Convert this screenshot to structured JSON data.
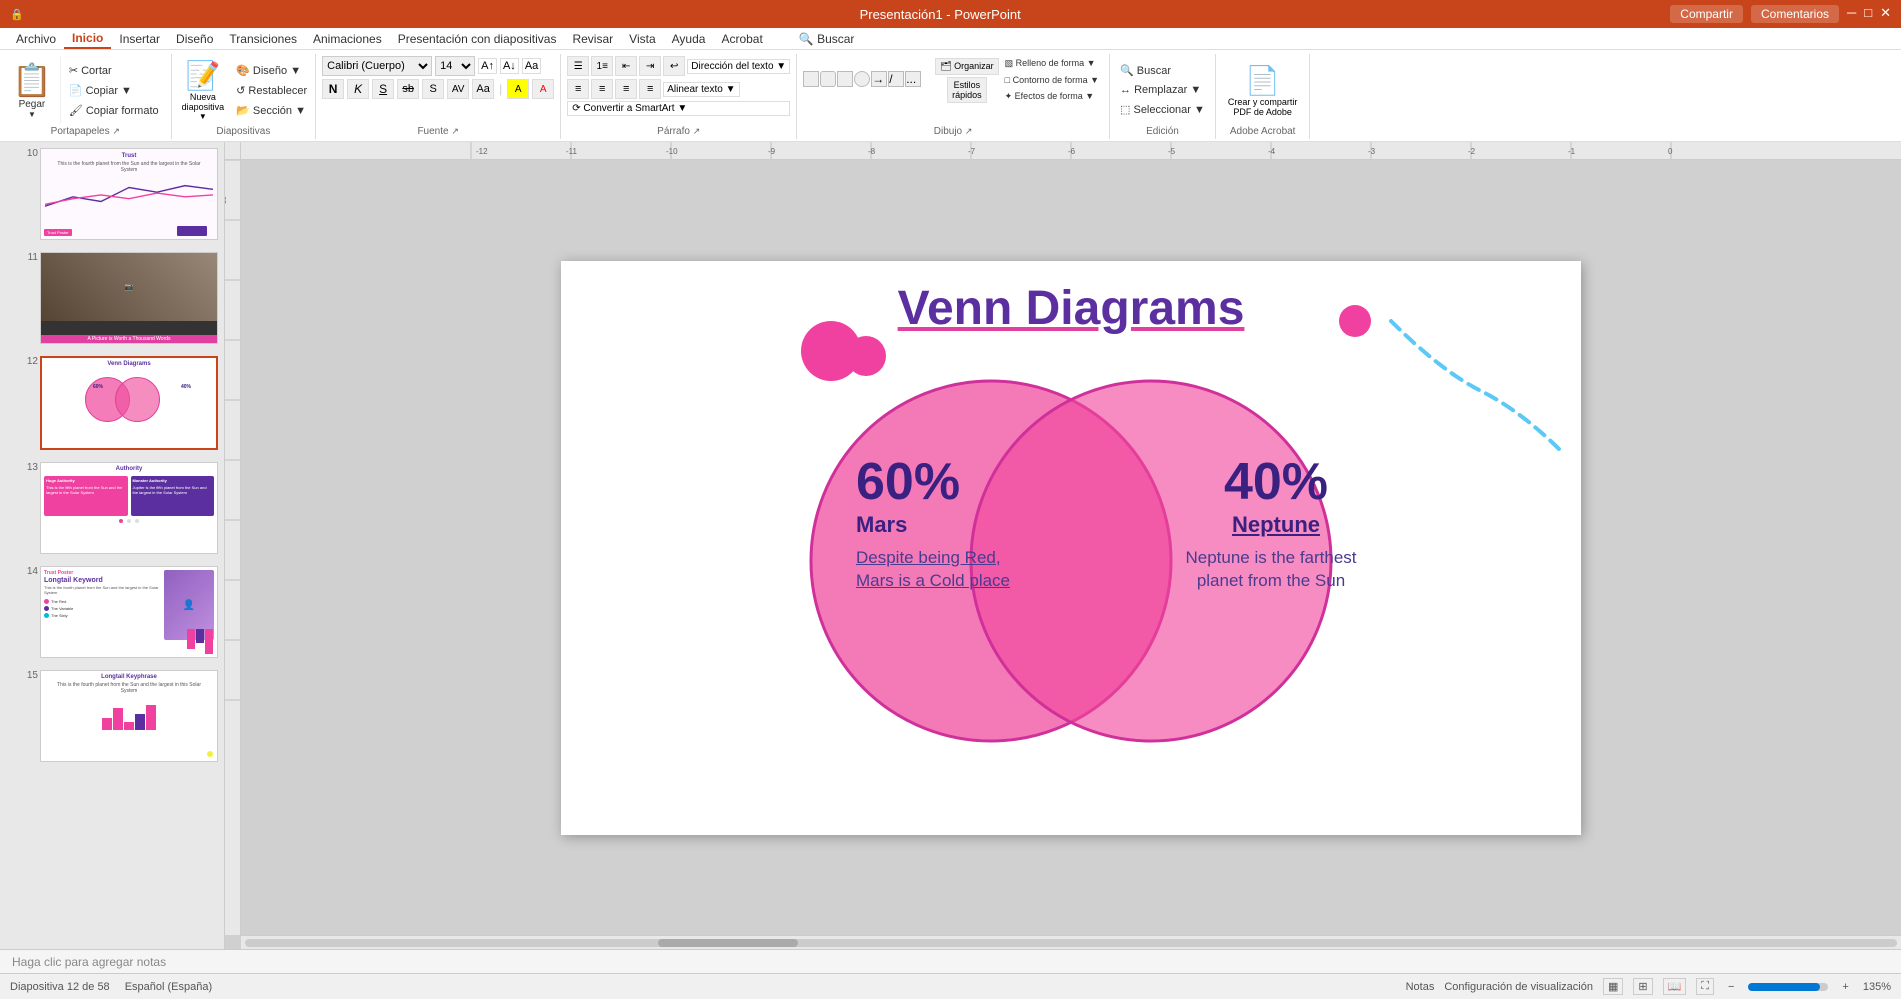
{
  "app": {
    "title": "Presentación1 - PowerPoint",
    "share_label": "Compartir",
    "comments_label": "Comentarios"
  },
  "menu": {
    "items": [
      "Archivo",
      "Inicio",
      "Insertar",
      "Diseño",
      "Transiciones",
      "Animaciones",
      "Presentación con diapositivas",
      "Revisar",
      "Vista",
      "Ayuda",
      "Acrobat",
      "Buscar"
    ]
  },
  "ribbon": {
    "groups": [
      {
        "label": "Portapapeles",
        "buttons": [
          "Pegar",
          "Cortar",
          "Copiar",
          "Copiar formato"
        ]
      },
      {
        "label": "Diapositivas",
        "buttons": [
          "Nueva diapositiva",
          "Diseño",
          "Restablecer",
          "Sección"
        ]
      },
      {
        "label": "Fuente",
        "buttons": [
          "N",
          "K",
          "S",
          "sb"
        ]
      },
      {
        "label": "Párrafo"
      },
      {
        "label": "Dibujo"
      },
      {
        "label": "Edición",
        "buttons": [
          "Buscar",
          "Remplazar",
          "Seleccionar"
        ]
      },
      {
        "label": "Adobe Acrobat",
        "buttons": [
          "Crear y compartir PDF de Adobe"
        ]
      }
    ]
  },
  "slides": [
    {
      "num": 10,
      "type": "trust",
      "title": "Trust"
    },
    {
      "num": 11,
      "type": "photo",
      "title": "A Picture is Worth a Thousand Words"
    },
    {
      "num": 12,
      "type": "venn",
      "title": "Venn Diagrams",
      "active": true
    },
    {
      "num": 13,
      "type": "authority",
      "title": "Authority"
    },
    {
      "num": 14,
      "type": "longtail",
      "title": "Longtail Keyword"
    },
    {
      "num": 15,
      "type": "longtail2",
      "title": "Longtail Keyphrase"
    }
  ],
  "current_slide": {
    "title": "Venn Diagrams",
    "left": {
      "percent": "60%",
      "planet": "Mars",
      "description": "Despite being Red, Mars is a Cold place"
    },
    "right": {
      "percent": "40%",
      "planet": "Neptune",
      "description": "Neptune is the farthest planet from the Sun"
    }
  },
  "notes": {
    "placeholder": "Haga clic para agregar notas"
  },
  "status": {
    "slide_info": "Diapositiva 12 de 58",
    "language": "Español (España)",
    "notes_label": "Notas",
    "view_settings": "Configuración de visualización",
    "zoom": "135%"
  },
  "colors": {
    "pink": "#f040a0",
    "purple": "#5c2fa0",
    "dark_purple": "#3a2080",
    "accent_red": "#c8441a",
    "light_purple": "#4a3a90",
    "venn_fill": "rgba(240, 80, 160, 0.72)"
  }
}
